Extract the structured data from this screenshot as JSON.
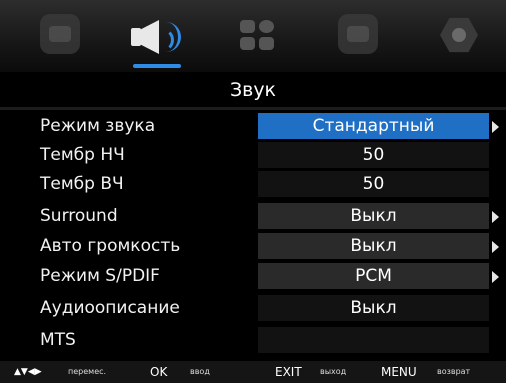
{
  "menu": {
    "tabs": [
      {
        "name": "picture-icon"
      },
      {
        "name": "sound-icon"
      },
      {
        "name": "apps-icon"
      },
      {
        "name": "settings-icon"
      },
      {
        "name": "lock-icon"
      }
    ],
    "active_tab": "sound",
    "title": "Звук",
    "accent_color": "#1f6fc5",
    "items": [
      {
        "label": "Режим звука",
        "value": "Стандартный",
        "arrow": true
      },
      {
        "label": "Тембр НЧ",
        "value": "50",
        "arrow": false
      },
      {
        "label": "Тембр ВЧ",
        "value": "50",
        "arrow": false
      },
      {
        "label": "Surround",
        "value": "Выкл",
        "arrow": true
      },
      {
        "label": "Авто громкость",
        "value": "Выкл",
        "arrow": true
      },
      {
        "label": "Режим S/PDIF",
        "value": "PCM",
        "arrow": true
      },
      {
        "label": "Аудиоописание",
        "value": "Выкл",
        "arrow": false
      },
      {
        "label": "MTS",
        "value": "",
        "arrow": false
      }
    ]
  },
  "footer": {
    "move_keys": "▲▼◀▶",
    "move_label": "перемес.",
    "ok_key": "OK",
    "ok_label": "ввод",
    "exit_key": "EXIT",
    "exit_label": "выход",
    "menu_key": "MENU",
    "menu_label": "возврат"
  }
}
